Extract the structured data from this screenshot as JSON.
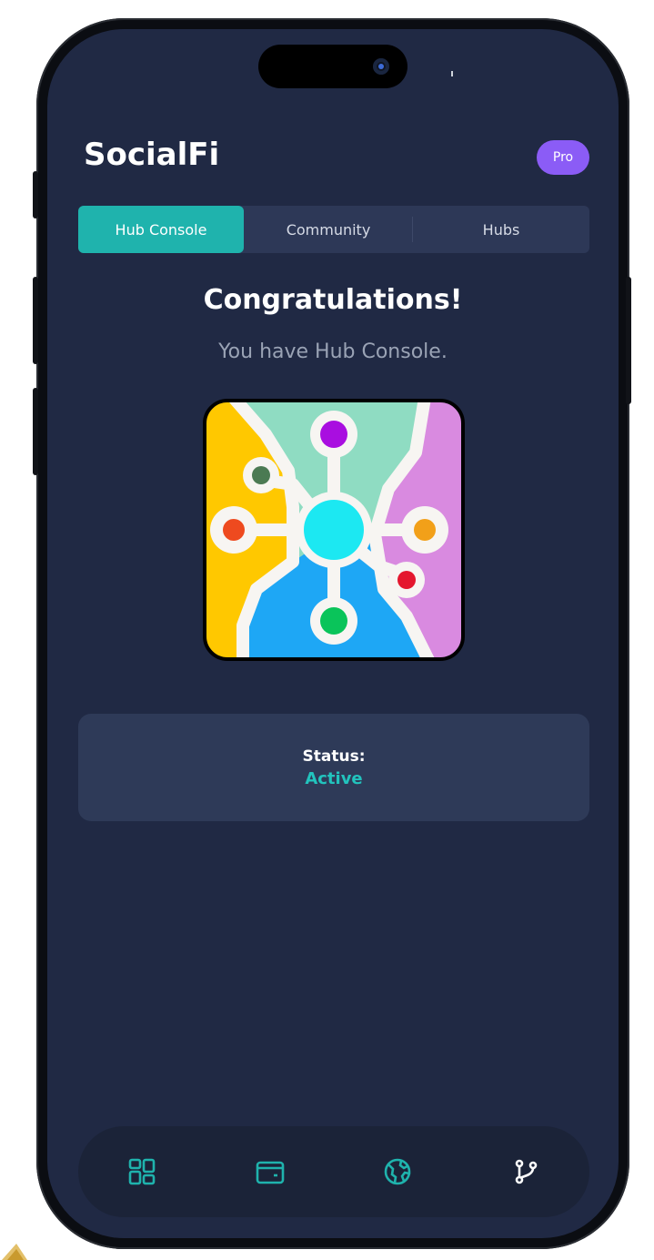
{
  "app": {
    "title": "SocialFi",
    "badge": "Pro"
  },
  "tabs": [
    {
      "label": "Hub Console",
      "active": true
    },
    {
      "label": "Community",
      "active": false
    },
    {
      "label": "Hubs",
      "active": false
    }
  ],
  "main": {
    "heading": "Congratulations!",
    "subheading": "You have Hub Console.",
    "image_icon": "hub-network-icon"
  },
  "status": {
    "label": "Status:",
    "value": "Active"
  },
  "bottom_nav": [
    {
      "icon": "dashboard-grid-icon"
    },
    {
      "icon": "wallet-icon"
    },
    {
      "icon": "globe-icon"
    },
    {
      "icon": "git-branch-icon"
    }
  ],
  "colors": {
    "background": "#202944",
    "accent": "#1fb3ad",
    "badge": "#8b5cf6",
    "card": "#2e3a58",
    "status_active": "#22c3bd"
  }
}
